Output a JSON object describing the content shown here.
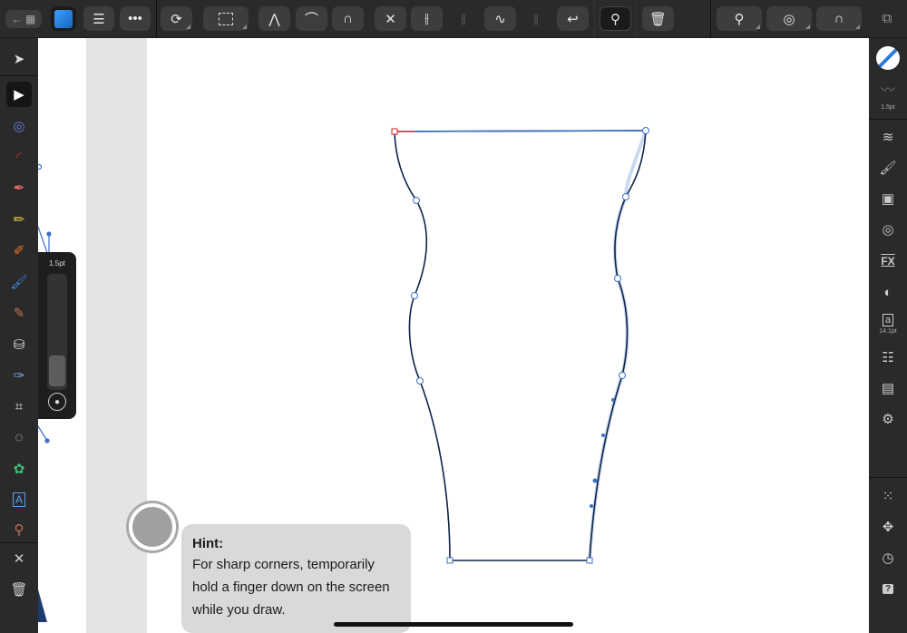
{
  "toolbar": {
    "items": [
      "back-to-gallery",
      "affinity-designer-logo",
      "menu",
      "more",
      "snapping-assistant",
      "transform-selection",
      "sharp-corner",
      "smart-corner",
      "smooth-corner",
      "break-curve",
      "join-curves",
      "split",
      "convert-to-smooth",
      "reverse",
      "close-curve",
      "select-all-nodes",
      "delete"
    ],
    "right": [
      "zoom",
      "view-mode",
      "snapping",
      "fullscreen"
    ]
  },
  "left_tools": [
    "move",
    "node",
    "corner",
    "gradient",
    "pen",
    "pencil",
    "vector-brush",
    "pixel-brush",
    "paint-brush",
    "fill",
    "transparency",
    "crop",
    "shape",
    "vector-flood",
    "artistic-text",
    "color-picker",
    "close",
    "delete"
  ],
  "right_panel": {
    "stroke_width": "1.5pt",
    "font_size": "14.1pt",
    "items": [
      "color",
      "stroke",
      "layers",
      "brushes",
      "appearance",
      "adjustments",
      "fx",
      "transparency",
      "text",
      "text-styles",
      "assets",
      "document",
      "grid",
      "transform",
      "history",
      "help"
    ]
  },
  "stroke_slider": {
    "label": "1.5pt",
    "value_fraction": 0.28
  },
  "hint": {
    "title": "Hint:",
    "body": "For sharp corners, temporarily hold a finger down on the screen while you draw."
  },
  "colors": {
    "accent": "#2e7be0",
    "curve": "#0d2448",
    "selection": "#3b6fc9"
  }
}
